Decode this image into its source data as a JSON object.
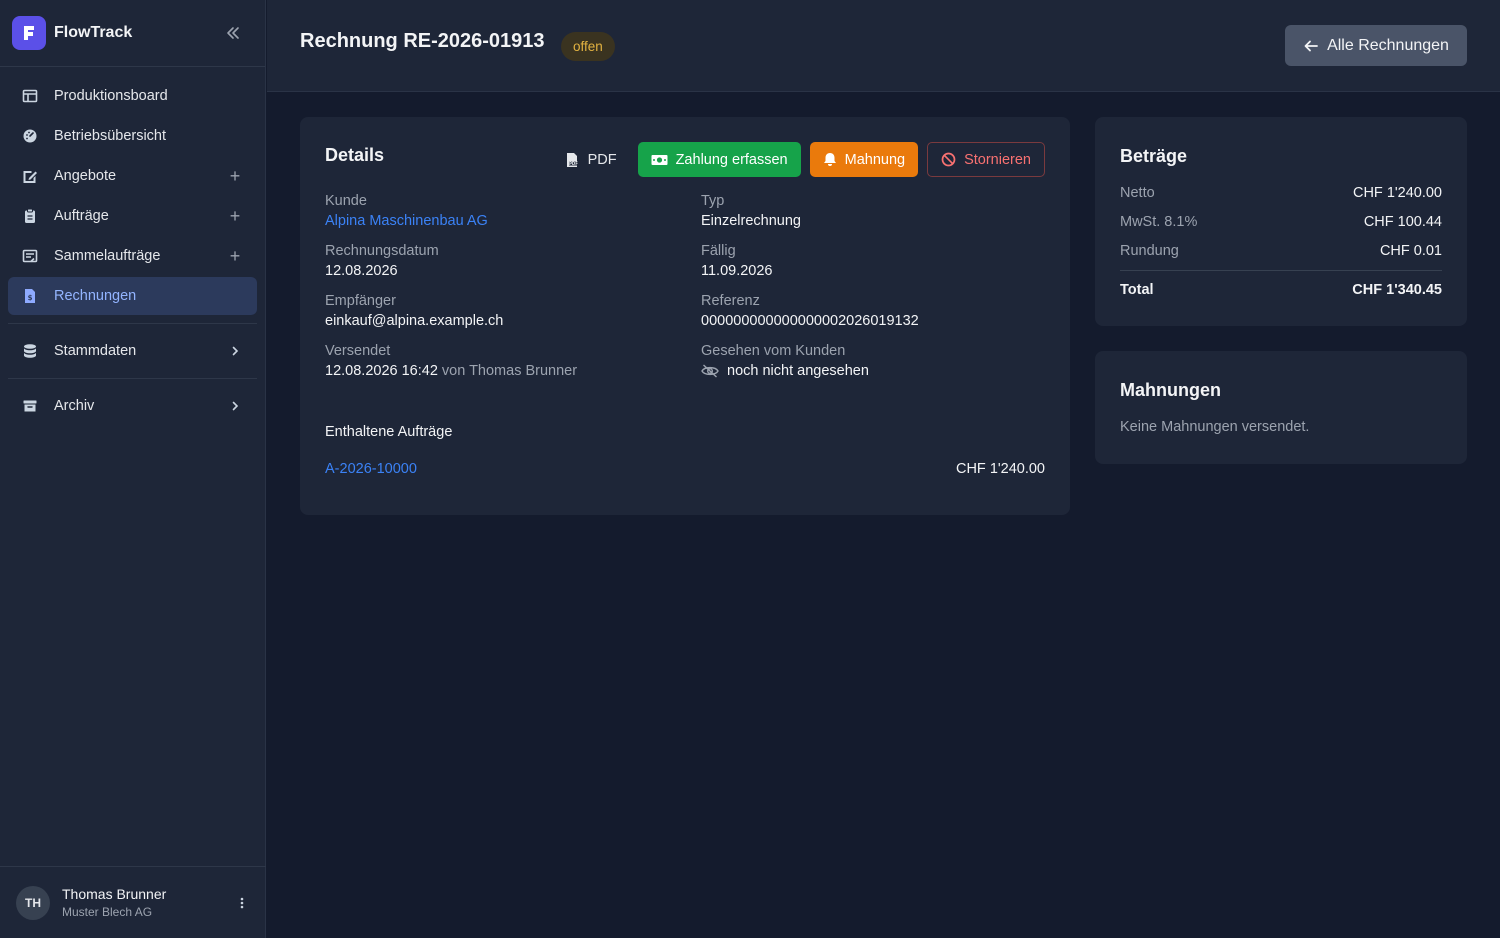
{
  "app": {
    "name": "FlowTrack"
  },
  "sidebar": {
    "items": [
      {
        "label": "Produktionsboard",
        "icon": "board-icon"
      },
      {
        "label": "Betriebsübersicht",
        "icon": "dashboard-icon"
      },
      {
        "label": "Angebote",
        "icon": "edit-document-icon",
        "tail": "+"
      },
      {
        "label": "Aufträge",
        "icon": "clipboard-icon",
        "tail": "+"
      },
      {
        "label": "Sammelaufträge",
        "icon": "collection-icon",
        "tail": "+"
      },
      {
        "label": "Rechnungen",
        "icon": "invoice-icon",
        "active": true
      },
      {
        "label": "Stammdaten",
        "icon": "database-icon",
        "tail": ">"
      },
      {
        "label": "Archiv",
        "icon": "archive-icon",
        "tail": ">"
      }
    ]
  },
  "user": {
    "initials": "TH",
    "name": "Thomas Brunner",
    "company": "Muster Blech AG"
  },
  "header": {
    "title": "Rechnung RE-2026-01913",
    "status": "offen",
    "back_label": "Alle Rechnungen"
  },
  "details": {
    "title": "Details",
    "actions": {
      "pdf": "PDF",
      "payment": "Zahlung erfassen",
      "dunning": "Mahnung",
      "cancel": "Stornieren"
    },
    "fields": {
      "customer": {
        "label": "Kunde",
        "value": "Alpina Maschinenbau AG"
      },
      "type": {
        "label": "Typ",
        "value": "Einzelrechnung"
      },
      "invoice_date": {
        "label": "Rechnungsdatum",
        "value": "12.08.2026"
      },
      "due": {
        "label": "Fällig",
        "value": "11.09.2026"
      },
      "recipient": {
        "label": "Empfänger",
        "value": "einkauf@alpina.example.ch"
      },
      "reference": {
        "label": "Referenz",
        "value": "000000000000000002026019132"
      },
      "sent": {
        "label": "Versendet",
        "value": "12.08.2026 16:42",
        "by": "von Thomas Brunner"
      },
      "seen": {
        "label": "Gesehen vom Kunden",
        "value": "noch nicht angesehen"
      }
    },
    "orders_heading": "Enthaltene Aufträge",
    "orders": [
      {
        "id": "A-2026-10000",
        "amount": "CHF 1'240.00"
      }
    ]
  },
  "amounts": {
    "title": "Beträge",
    "net": {
      "label": "Netto",
      "value": "CHF 1'240.00"
    },
    "vat": {
      "label": "MwSt. 8.1%",
      "value": "CHF 100.44"
    },
    "rounding": {
      "label": "Rundung",
      "value": "CHF 0.01"
    },
    "total": {
      "label": "Total",
      "value": "CHF 1'340.45"
    }
  },
  "dunning": {
    "title": "Mahnungen",
    "empty": "Keine Mahnungen versendet."
  },
  "colors": {
    "accent": "#5b50e8",
    "active_bg": "#2c3a5c",
    "success": "#16a34a",
    "warning": "#ea7a0c",
    "danger": "#f87171",
    "link": "#3b82f6",
    "status_text": "#e3b341"
  }
}
